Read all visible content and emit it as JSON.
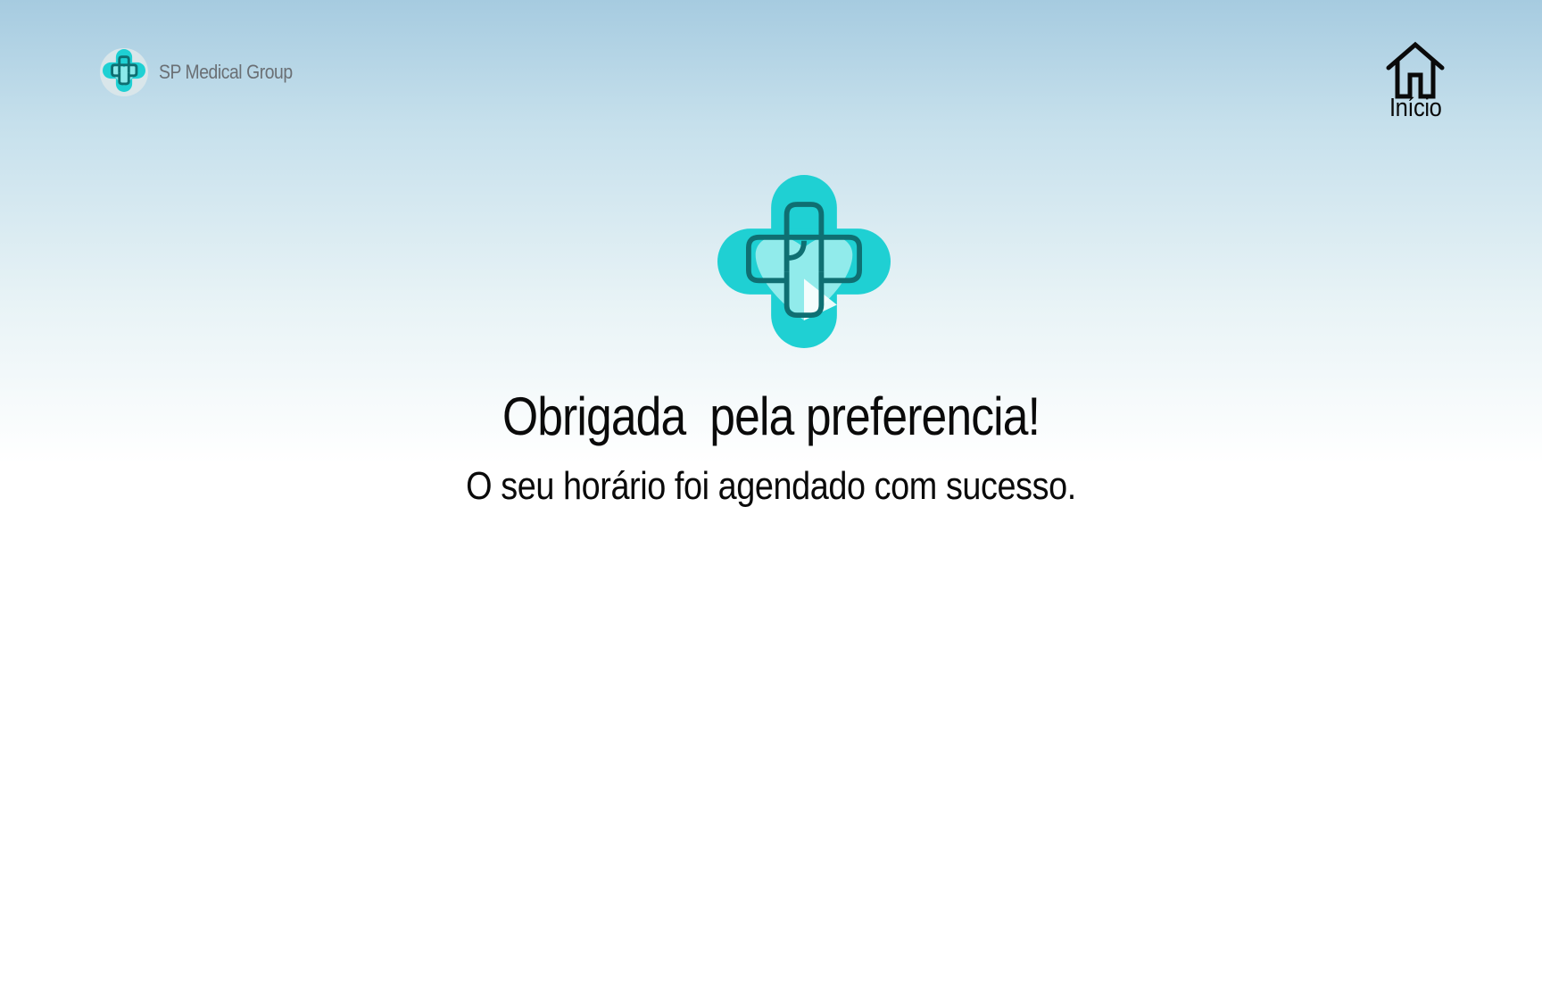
{
  "header": {
    "brand_name": "SP Medical Group",
    "logo_icon": "medical-cross-heart-icon",
    "home_icon": "home-icon",
    "home_label": "Início"
  },
  "main": {
    "logo_icon": "medical-cross-heart-icon",
    "headline": "Obrigada  pela preferencia!",
    "subline": "O seu horário foi agendado com sucesso."
  },
  "colors": {
    "accent_turquoise": "#1fd0d3",
    "accent_dark_teal": "#0f6f72",
    "text": "#0a0a0a",
    "brand_text": "#6a6f74"
  }
}
